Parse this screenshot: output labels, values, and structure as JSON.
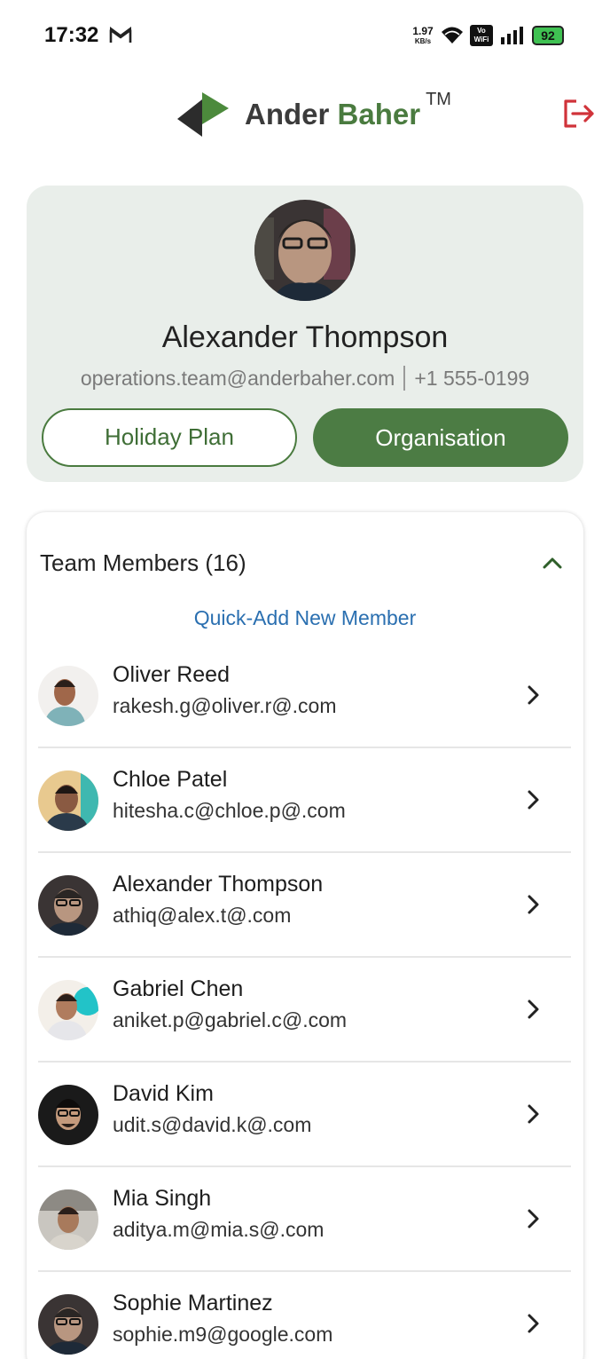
{
  "status_bar": {
    "time": "17:32",
    "net_speed_value": "1.97",
    "net_speed_unit": "KB/s",
    "vowifi_line1": "Vo",
    "vowifi_line2": "WiFi",
    "battery": "92"
  },
  "header": {
    "brand_first": "Ander",
    "brand_second": "Baher",
    "trademark": "TM",
    "icons": {
      "logo": "brand-logo-mark",
      "logout": "logout-icon"
    }
  },
  "profile": {
    "name": "Alexander Thompson",
    "email": "operations.team@anderbaher.com",
    "phone": "+1 555-0199",
    "buttons": {
      "holiday": "Holiday Plan",
      "organisation": "Organisation"
    }
  },
  "team": {
    "title": "Team Members (16)",
    "quick_add": "Quick-Add New Member",
    "members": [
      {
        "name": "Oliver Reed",
        "email": "rakesh.g@oliver.r@.com"
      },
      {
        "name": "Chloe Patel",
        "email": "hitesha.c@chloe.p@.com"
      },
      {
        "name": "Alexander Thompson",
        "email": "athiq@alex.t@.com"
      },
      {
        "name": "Gabriel Chen",
        "email": "aniket.p@gabriel.c@.com"
      },
      {
        "name": "David Kim",
        "email": "udit.s@david.k@.com"
      },
      {
        "name": "Mia Singh",
        "email": "aditya.m@mia.s@.com"
      },
      {
        "name": "Sophie Martinez",
        "email": "sophie.m9@google.com"
      }
    ]
  },
  "colors": {
    "brand_green": "#4c7c44",
    "card_background": "#e9eeea",
    "link_blue": "#2a6fb0",
    "logout_red": "#d0333a"
  }
}
